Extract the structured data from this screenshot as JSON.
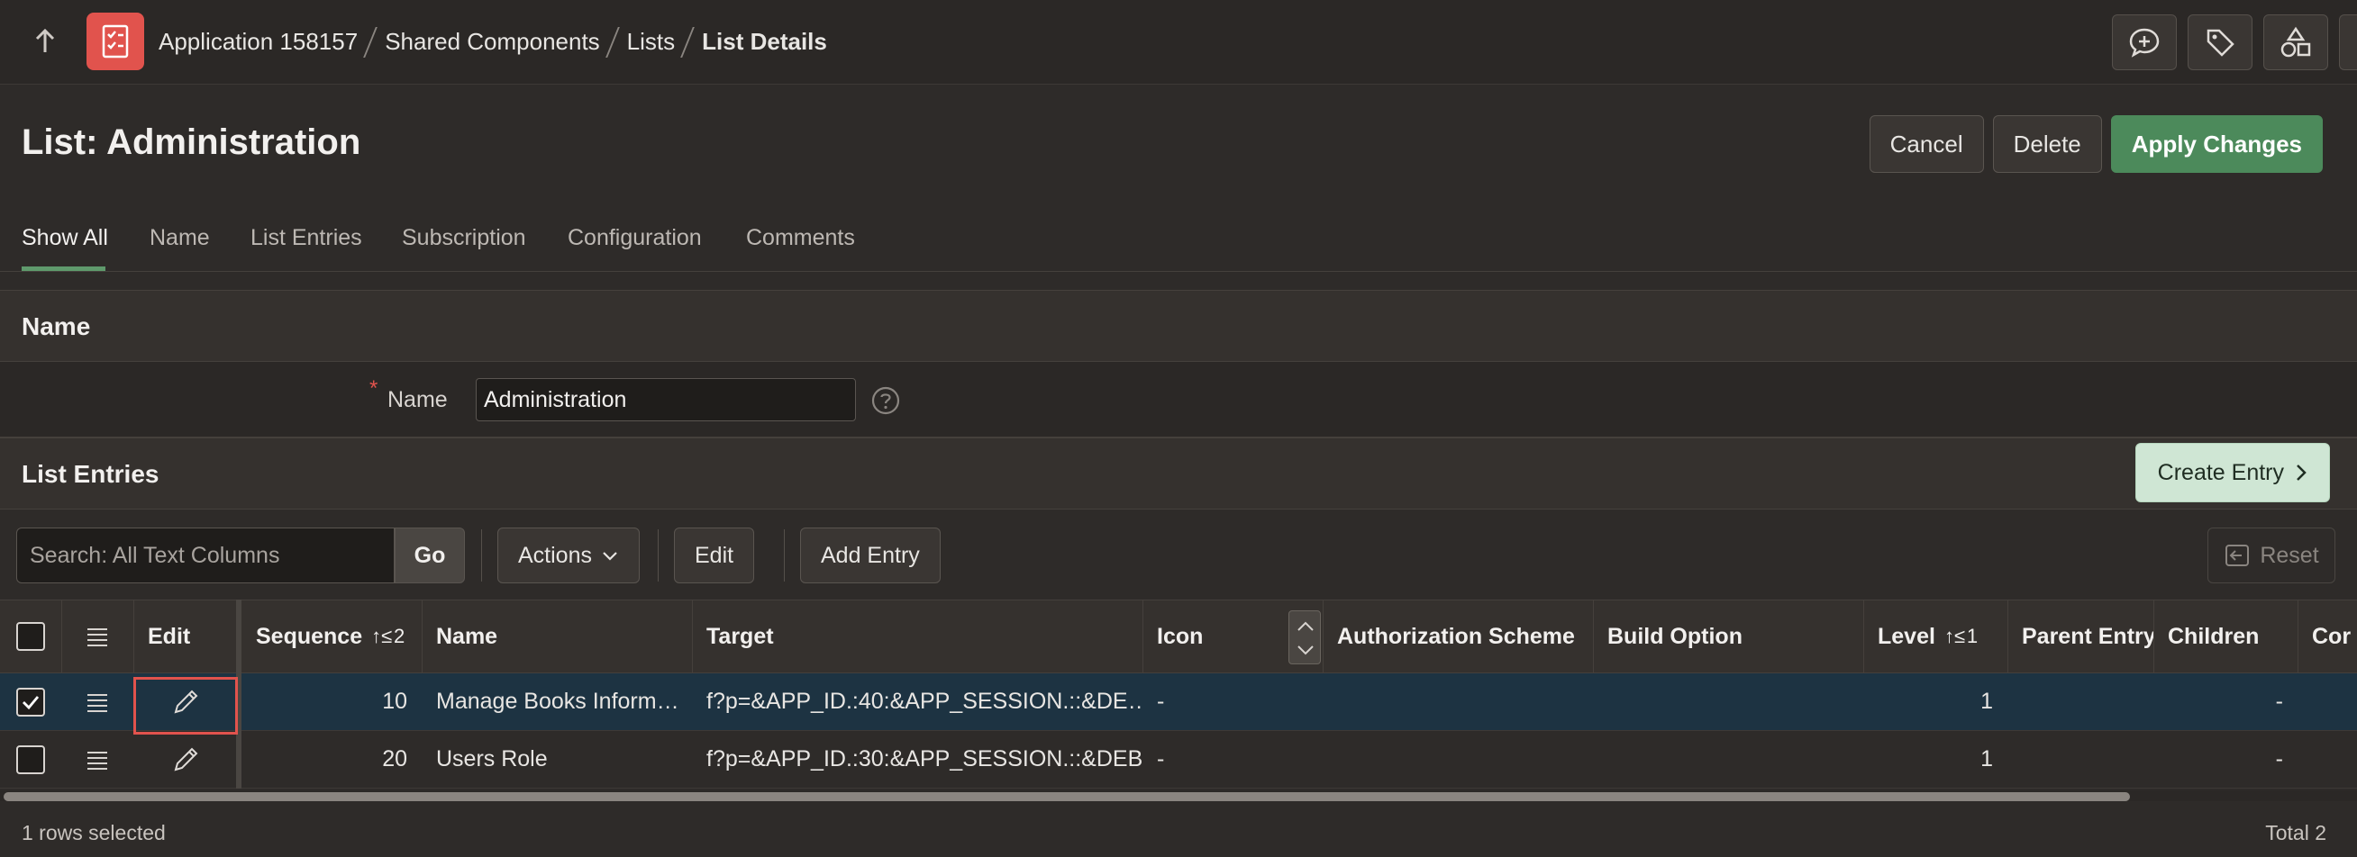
{
  "breadcrumb": {
    "app": "Application 158157",
    "shared": "Shared Components",
    "lists": "Lists",
    "current": "List Details"
  },
  "icons": {
    "up": "arrow-up-icon",
    "app": "app-checklist-icon",
    "feedback": "chat-plus-icon",
    "tag": "tag-icon",
    "shapes": "shapes-icon"
  },
  "page": {
    "title": "List: Administration",
    "cancel_label": "Cancel",
    "delete_label": "Delete",
    "apply_label": "Apply Changes"
  },
  "tabs": [
    "Show All",
    "Name",
    "List Entries",
    "Subscription",
    "Configuration",
    "Comments"
  ],
  "name_region": {
    "title": "Name",
    "required_marker": "*",
    "field_label": "Name",
    "field_value": "Administration"
  },
  "entries_region": {
    "title": "List Entries",
    "create_label": "Create Entry"
  },
  "toolbar": {
    "search_placeholder": "Search: All Text Columns",
    "go_label": "Go",
    "actions_label": "Actions",
    "edit_label": "Edit",
    "add_entry_label": "Add Entry",
    "reset_label": "Reset"
  },
  "grid": {
    "columns": {
      "edit": "Edit",
      "sequence": "Sequence",
      "sequence_sort": "↑≤ 2",
      "name": "Name",
      "target": "Target",
      "icon": "Icon",
      "auth": "Authorization Scheme",
      "build": "Build Option",
      "level": "Level",
      "level_sort": "↑≤ 1",
      "parent": "Parent Entry",
      "children": "Children",
      "more": "Cor"
    },
    "rows": [
      {
        "selected": true,
        "sequence": "10",
        "name": "Manage Books Inform…",
        "target": "f?p=&APP_ID.:40:&APP_SESSION.::&DE…",
        "icon": "-",
        "auth": "",
        "build": "",
        "level": "1",
        "parent": "",
        "children": "-"
      },
      {
        "selected": false,
        "sequence": "20",
        "name": "Users Role",
        "target": "f?p=&APP_ID.:30:&APP_SESSION.::&DEB…",
        "icon": "-",
        "auth": "",
        "build": "",
        "level": "1",
        "parent": "",
        "children": "-"
      }
    ]
  },
  "footer": {
    "selected_text": "1 rows selected",
    "total_text": "Total 2"
  },
  "colors": {
    "accent_green": "#4c8a5b",
    "app_badge": "#e1534d",
    "selected_row": "#1d3342"
  }
}
